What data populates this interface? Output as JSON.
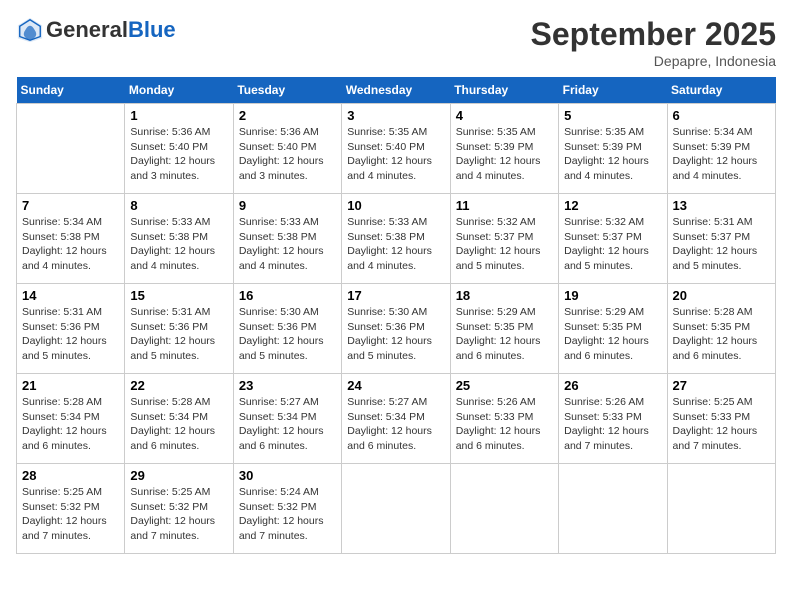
{
  "header": {
    "logo_general": "General",
    "logo_blue": "Blue",
    "month_title": "September 2025",
    "location": "Depapre, Indonesia"
  },
  "weekdays": [
    "Sunday",
    "Monday",
    "Tuesday",
    "Wednesday",
    "Thursday",
    "Friday",
    "Saturday"
  ],
  "weeks": [
    [
      {
        "day": "",
        "info": ""
      },
      {
        "day": "1",
        "info": "Sunrise: 5:36 AM\nSunset: 5:40 PM\nDaylight: 12 hours\nand 3 minutes."
      },
      {
        "day": "2",
        "info": "Sunrise: 5:36 AM\nSunset: 5:40 PM\nDaylight: 12 hours\nand 3 minutes."
      },
      {
        "day": "3",
        "info": "Sunrise: 5:35 AM\nSunset: 5:40 PM\nDaylight: 12 hours\nand 4 minutes."
      },
      {
        "day": "4",
        "info": "Sunrise: 5:35 AM\nSunset: 5:39 PM\nDaylight: 12 hours\nand 4 minutes."
      },
      {
        "day": "5",
        "info": "Sunrise: 5:35 AM\nSunset: 5:39 PM\nDaylight: 12 hours\nand 4 minutes."
      },
      {
        "day": "6",
        "info": "Sunrise: 5:34 AM\nSunset: 5:39 PM\nDaylight: 12 hours\nand 4 minutes."
      }
    ],
    [
      {
        "day": "7",
        "info": "Sunrise: 5:34 AM\nSunset: 5:38 PM\nDaylight: 12 hours\nand 4 minutes."
      },
      {
        "day": "8",
        "info": "Sunrise: 5:33 AM\nSunset: 5:38 PM\nDaylight: 12 hours\nand 4 minutes."
      },
      {
        "day": "9",
        "info": "Sunrise: 5:33 AM\nSunset: 5:38 PM\nDaylight: 12 hours\nand 4 minutes."
      },
      {
        "day": "10",
        "info": "Sunrise: 5:33 AM\nSunset: 5:38 PM\nDaylight: 12 hours\nand 4 minutes."
      },
      {
        "day": "11",
        "info": "Sunrise: 5:32 AM\nSunset: 5:37 PM\nDaylight: 12 hours\nand 5 minutes."
      },
      {
        "day": "12",
        "info": "Sunrise: 5:32 AM\nSunset: 5:37 PM\nDaylight: 12 hours\nand 5 minutes."
      },
      {
        "day": "13",
        "info": "Sunrise: 5:31 AM\nSunset: 5:37 PM\nDaylight: 12 hours\nand 5 minutes."
      }
    ],
    [
      {
        "day": "14",
        "info": "Sunrise: 5:31 AM\nSunset: 5:36 PM\nDaylight: 12 hours\nand 5 minutes."
      },
      {
        "day": "15",
        "info": "Sunrise: 5:31 AM\nSunset: 5:36 PM\nDaylight: 12 hours\nand 5 minutes."
      },
      {
        "day": "16",
        "info": "Sunrise: 5:30 AM\nSunset: 5:36 PM\nDaylight: 12 hours\nand 5 minutes."
      },
      {
        "day": "17",
        "info": "Sunrise: 5:30 AM\nSunset: 5:36 PM\nDaylight: 12 hours\nand 5 minutes."
      },
      {
        "day": "18",
        "info": "Sunrise: 5:29 AM\nSunset: 5:35 PM\nDaylight: 12 hours\nand 6 minutes."
      },
      {
        "day": "19",
        "info": "Sunrise: 5:29 AM\nSunset: 5:35 PM\nDaylight: 12 hours\nand 6 minutes."
      },
      {
        "day": "20",
        "info": "Sunrise: 5:28 AM\nSunset: 5:35 PM\nDaylight: 12 hours\nand 6 minutes."
      }
    ],
    [
      {
        "day": "21",
        "info": "Sunrise: 5:28 AM\nSunset: 5:34 PM\nDaylight: 12 hours\nand 6 minutes."
      },
      {
        "day": "22",
        "info": "Sunrise: 5:28 AM\nSunset: 5:34 PM\nDaylight: 12 hours\nand 6 minutes."
      },
      {
        "day": "23",
        "info": "Sunrise: 5:27 AM\nSunset: 5:34 PM\nDaylight: 12 hours\nand 6 minutes."
      },
      {
        "day": "24",
        "info": "Sunrise: 5:27 AM\nSunset: 5:34 PM\nDaylight: 12 hours\nand 6 minutes."
      },
      {
        "day": "25",
        "info": "Sunrise: 5:26 AM\nSunset: 5:33 PM\nDaylight: 12 hours\nand 6 minutes."
      },
      {
        "day": "26",
        "info": "Sunrise: 5:26 AM\nSunset: 5:33 PM\nDaylight: 12 hours\nand 7 minutes."
      },
      {
        "day": "27",
        "info": "Sunrise: 5:25 AM\nSunset: 5:33 PM\nDaylight: 12 hours\nand 7 minutes."
      }
    ],
    [
      {
        "day": "28",
        "info": "Sunrise: 5:25 AM\nSunset: 5:32 PM\nDaylight: 12 hours\nand 7 minutes."
      },
      {
        "day": "29",
        "info": "Sunrise: 5:25 AM\nSunset: 5:32 PM\nDaylight: 12 hours\nand 7 minutes."
      },
      {
        "day": "30",
        "info": "Sunrise: 5:24 AM\nSunset: 5:32 PM\nDaylight: 12 hours\nand 7 minutes."
      },
      {
        "day": "",
        "info": ""
      },
      {
        "day": "",
        "info": ""
      },
      {
        "day": "",
        "info": ""
      },
      {
        "day": "",
        "info": ""
      }
    ]
  ]
}
